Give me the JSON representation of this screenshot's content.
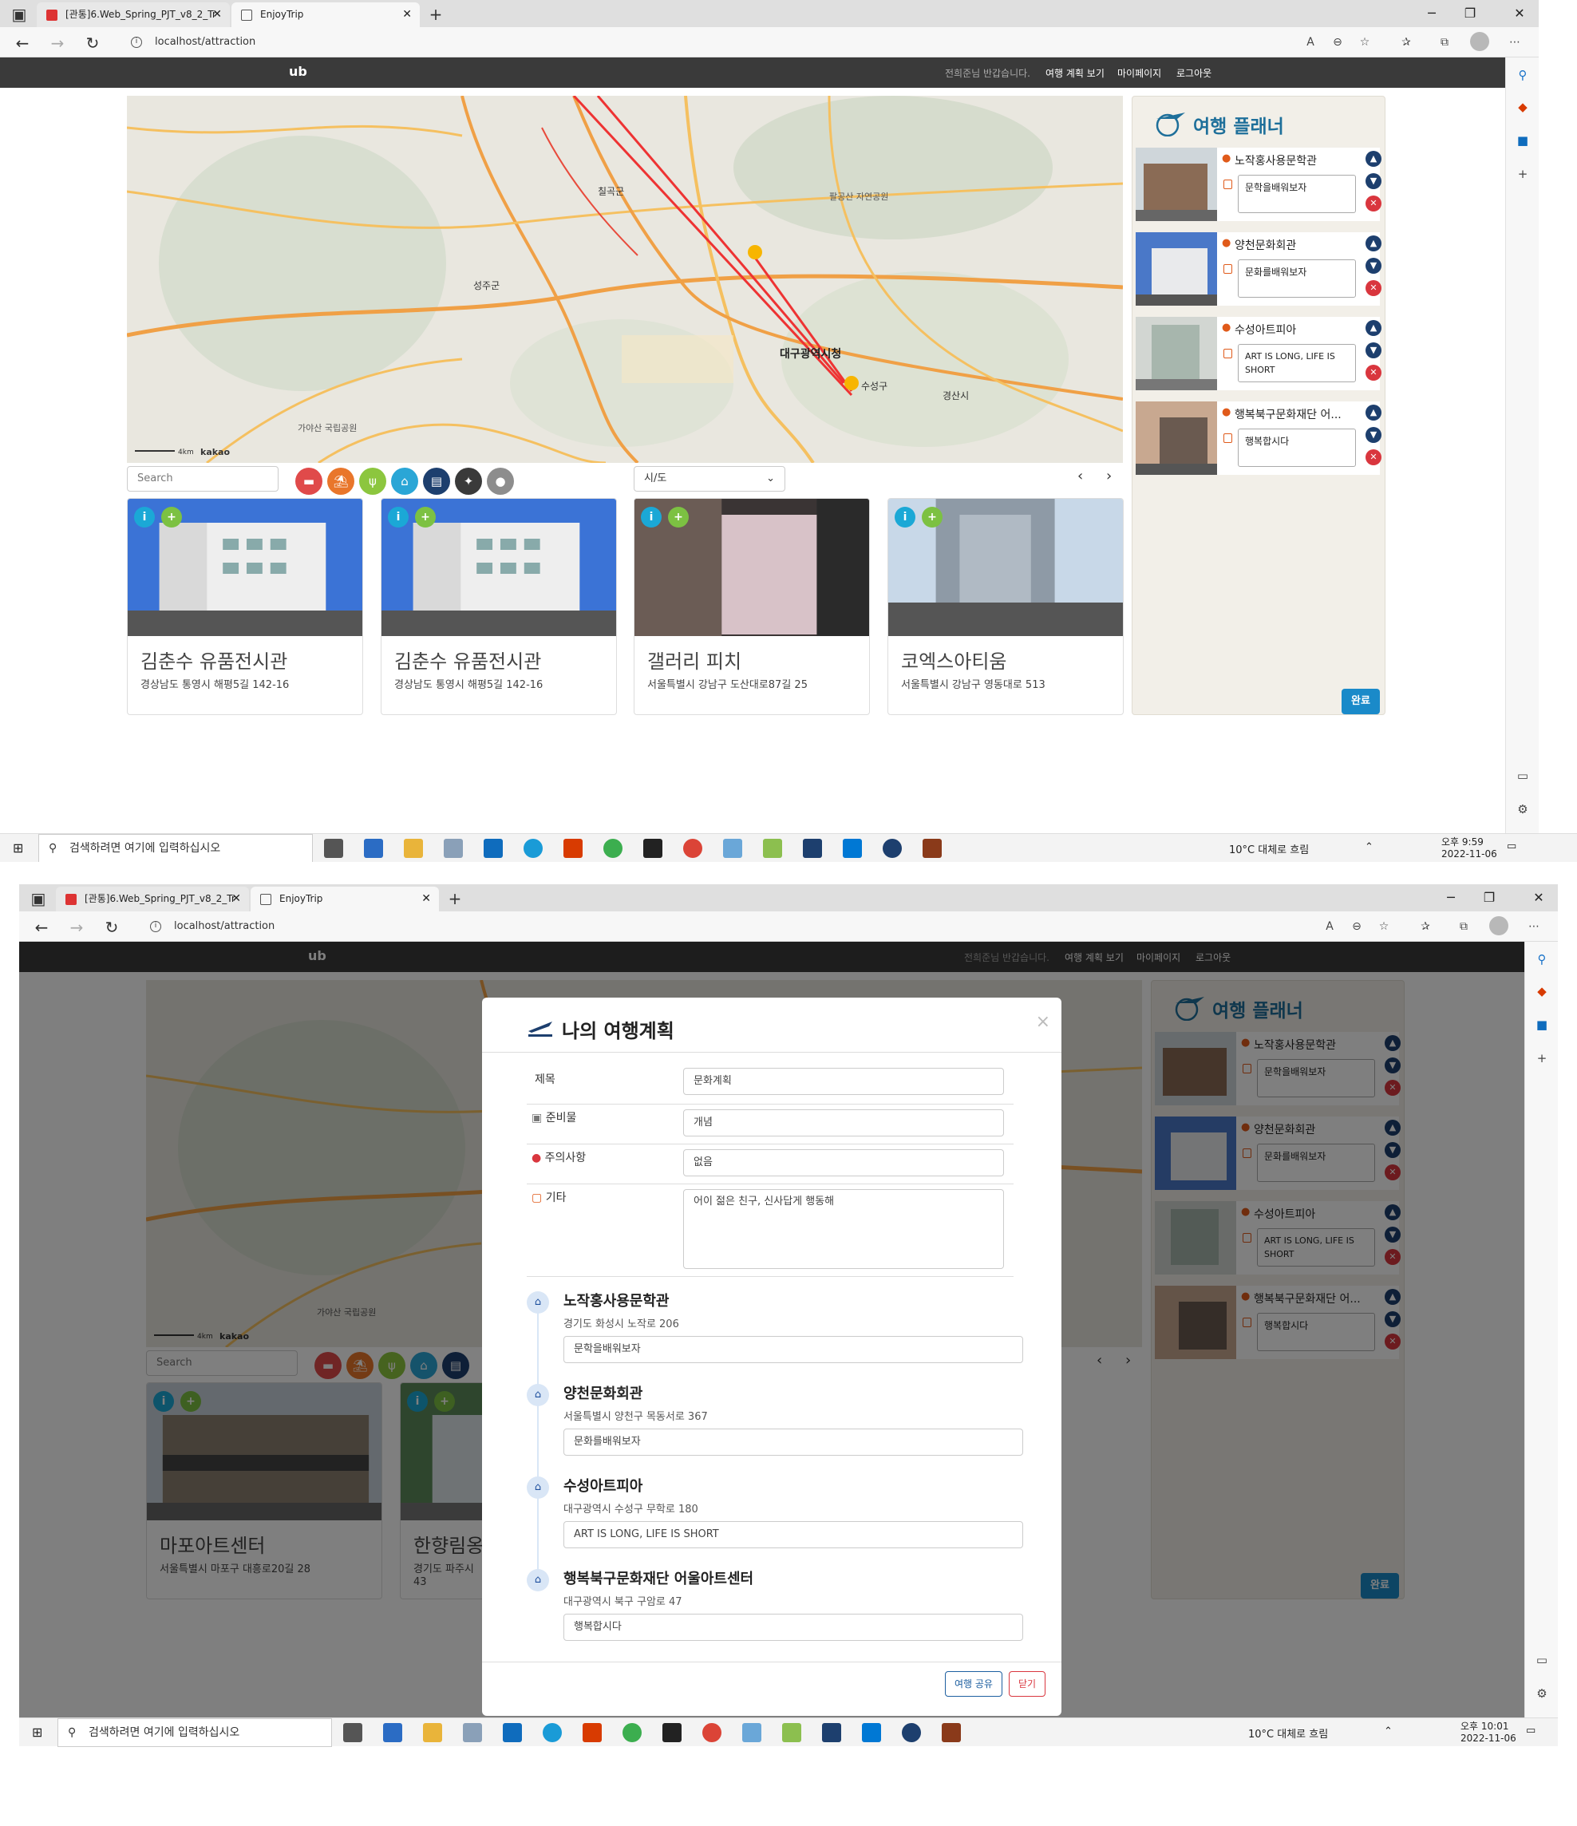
{
  "browser": {
    "tabs": [
      "[관통]6.Web_Spring_PJT_v8_2_Tr",
      "EnjoyTrip"
    ],
    "new_tab": "+",
    "url": "localhost/attraction",
    "controls": {
      "minimize": "─",
      "restore": "❐",
      "close": "✕"
    }
  },
  "site": {
    "logo": "ub",
    "greeting": "전희준님 반갑습니다.",
    "nav": [
      "여행 계획 보기",
      "마이페이지",
      "로그아웃"
    ]
  },
  "map": {
    "scale": "4km",
    "brand": "kakao",
    "city_label": "대구광역시청",
    "places": [
      "성주군",
      "칠곡군",
      "경산시",
      "수성구",
      "가야산 국립공원",
      "팔공산 자연공원"
    ]
  },
  "search": {
    "placeholder": "Search"
  },
  "region_select": "시/도",
  "categories": [
    {
      "icon": "hotel-icon",
      "color": "#e04a4a"
    },
    {
      "icon": "beach-icon",
      "color": "#e9762b"
    },
    {
      "icon": "food-icon",
      "color": "#8cc63e"
    },
    {
      "icon": "museum-icon",
      "color": "#2aa6d6"
    },
    {
      "icon": "shop-icon",
      "color": "#1d3f6e"
    },
    {
      "icon": "activity-icon",
      "color": "#3a3a3a"
    },
    {
      "icon": "pin-icon",
      "color": "#8d8d8d"
    }
  ],
  "pager": {
    "prev": "‹",
    "next": "›"
  },
  "cards_top": [
    {
      "title": "김춘수 유품전시관",
      "address": "경상남도 통영시 해평5길 142-16"
    },
    {
      "title": "김춘수 유품전시관",
      "address": "경상남도 통영시 해평5길 142-16"
    },
    {
      "title": "갤러리 피치",
      "address": "서울특별시 강남구 도산대로87길 25"
    },
    {
      "title": "코엑스아티움",
      "address": "서울특별시 강남구 영동대로 513"
    }
  ],
  "cards_bottom": [
    {
      "title": "마포아트센터",
      "address": "서울특별시 마포구 대흥로20길 28"
    },
    {
      "title": "한향림옹",
      "address": "경기도 파주시"
    },
    {
      "title": "",
      "address": "43"
    }
  ],
  "card_buttons": {
    "info": "i",
    "add": "+"
  },
  "planner": {
    "title": "여행 플래너",
    "done": "완료",
    "items": [
      {
        "name": "노작홍사용문학관",
        "memo": "문학을배워보자"
      },
      {
        "name": "양천문화회관",
        "memo": "문화를배워보자"
      },
      {
        "name": "수성아트피아",
        "memo": "ART IS LONG, LIFE IS SHORT"
      },
      {
        "name": "행복북구문화재단 어...",
        "memo": "행복합시다"
      }
    ]
  },
  "modal": {
    "title": "나의 여행계획",
    "close": "×",
    "fields": [
      {
        "label": "제목",
        "value": "문화계획"
      },
      {
        "label": "준비물",
        "value": "개념"
      },
      {
        "label": "주의사항",
        "value": "없음"
      },
      {
        "label": "기타",
        "value": "어이 젊은 친구, 신사답게 행동해"
      }
    ],
    "spots": [
      {
        "name": "노작홍사용문학관",
        "address": "경기도 화성시 노작로 206",
        "memo": "문학을배워보자"
      },
      {
        "name": "양천문화회관",
        "address": "서울특별시 양천구 목동서로 367",
        "memo": "문화를배워보자"
      },
      {
        "name": "수성아트피아",
        "address": "대구광역시 수성구 무학로 180",
        "memo": "ART IS LONG, LIFE IS SHORT"
      },
      {
        "name": "행복북구문화재단 어울아트센터",
        "address": "대구광역시 북구 구암로 47",
        "memo": "행복합시다"
      }
    ],
    "share_button": "여행 공유",
    "close_button": "닫기"
  },
  "taskbar": {
    "search_placeholder": "검색하려면 여기에 입력하십시오",
    "weather": "10°C  대체로 흐림",
    "shot1": {
      "time": "오후 9:59",
      "date": "2022-11-06"
    },
    "shot2": {
      "time": "오후 10:01",
      "date": "2022-11-06"
    }
  }
}
